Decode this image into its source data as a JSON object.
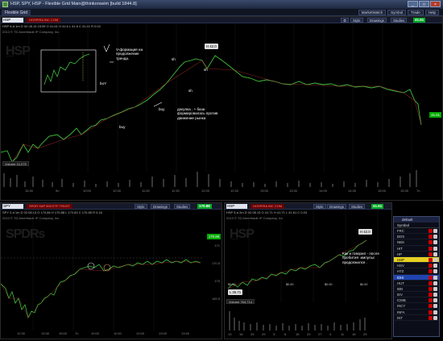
{
  "window": {
    "title": "HSP, SPY, HSP - Flexible Grid Main@thinkorswim [build 1844.8]",
    "buttons": [
      "_",
      "□",
      "×"
    ]
  },
  "menubar": {
    "tab": "Flexible Grid",
    "buttons": [
      "MarketWatch",
      "Symbol",
      "Trade",
      "Help"
    ]
  },
  "top_panel": {
    "symbol": "HSP",
    "flag": "HOSPIRA INC COM",
    "price": "41.61",
    "toolbar": [
      "Style",
      "Drawings",
      "Studies"
    ],
    "quote": "HSP 6-d 1m  D 02.08.13 15:59  O 41.61  H 41.6  L 41.6  C 41.61  R 0.02",
    "copyright": "2013 © TD Ameritrade IP Company, Inc.",
    "price_tag": "41.61",
    "high_badge": "H 42.0",
    "volume_label": "Volume 10,079",
    "x_ticks": [
      "15:30",
      "9n",
      "10:00",
      "10:30",
      "11:00",
      "11:30",
      "12:00",
      "12:30",
      "13:00",
      "13:30",
      "14:00",
      "14:30",
      "15:00",
      "15:30",
      "7n"
    ],
    "annotations": {
      "v_formation": "V-формация на\nпродолжение\nтренда.",
      "buy_box": "buY",
      "sh1": "sh",
      "sh2": "sh",
      "sh3": "sh",
      "buy_mid": "buy",
      "base_note": "докупка , + база\nформировалась против\nдвижение рынка",
      "buy_low": "buy"
    }
  },
  "spy_panel": {
    "symbol": "SPY",
    "flag": "SPDR S&P 500 ETF TRUST",
    "price": "170.88",
    "toolbar": [
      "Style",
      "Drawings",
      "Studies"
    ],
    "quote": "SPY 2-d 1m  D 02.08.13  O 170.86  H 170.88  L 170.83  C 170.85  R 0.16",
    "copyright": "2013 © TD Ameritrade IP Company, Inc.",
    "y_ticks": [
      "171",
      "170.5",
      "170",
      "169.5"
    ],
    "x_ticks": [
      "12:30",
      "13:30",
      "15:00",
      "7n",
      "10:00",
      "11:00",
      "12:00",
      "13:00",
      "13:40"
    ]
  },
  "hsp2_panel": {
    "symbol": "HSP",
    "flag": "HOSPIRA INC COM",
    "price": "41.61",
    "toolbar": [
      "Style",
      "Drawings",
      "Studies"
    ],
    "quote": "HSP 5-d 2m  D 02.08.13  O 41.71  H 41.71  L 41.61  C 0.03",
    "copyright": "2013 © TD Ameritrade IP Company, Inc.",
    "high_badge": "H 42.0",
    "low_badge": "L 36.71",
    "div_labels": [
      "$0.00",
      "$0.00",
      "$0.00",
      "$0.00"
    ],
    "note": "Как и говорил - после\nпробития  импульс\nпродолжился .",
    "volume_label": "Volume 764,714",
    "x_ticks": [
      "13",
      "18",
      "25",
      "29",
      "3",
      "8",
      "15",
      "20",
      "27",
      "4",
      "11",
      "18",
      "25"
    ]
  },
  "watchlist": {
    "title": "default",
    "header": "Symbol",
    "rows": [
      "FRC",
      "BOS",
      "NBS",
      "HIT",
      "HP",
      "HSP",
      "HSV",
      "HTZ",
      "IDIX",
      "HUT",
      "IBN",
      "IEV",
      "ICMB",
      "INCY",
      "INFA",
      "INT"
    ],
    "selected": "HSP",
    "highlighted": "IDIX"
  }
}
